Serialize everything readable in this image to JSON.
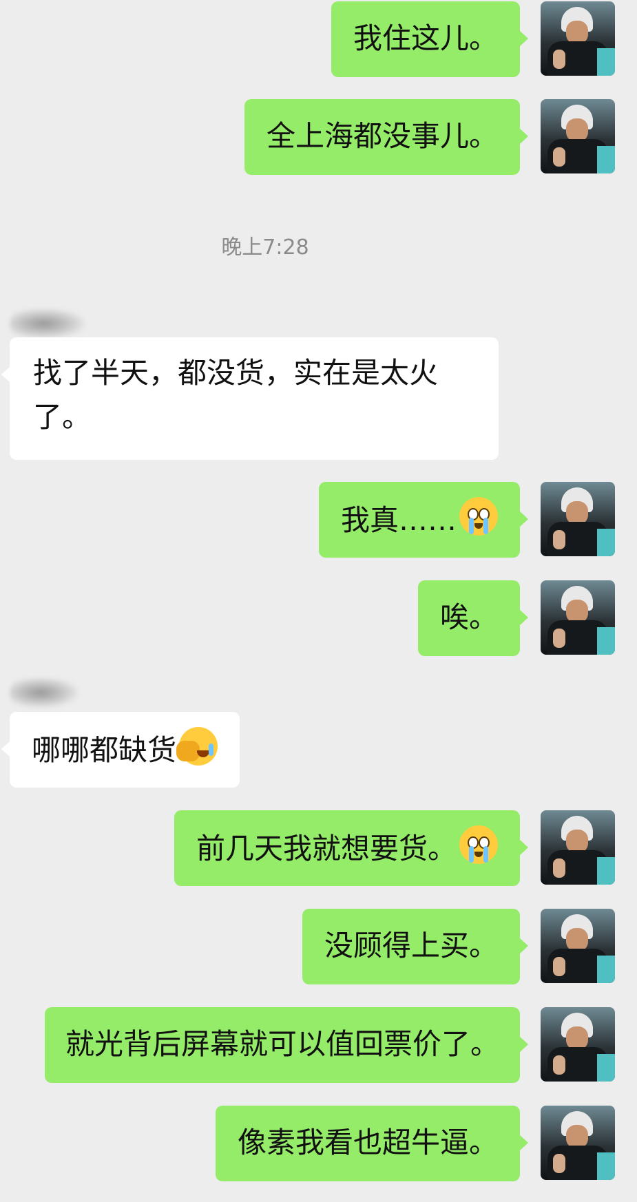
{
  "timestamp": "晚上7:28",
  "messages": [
    {
      "from": "me",
      "text": "我住这儿。"
    },
    {
      "from": "me",
      "text": "全上海都没事儿。"
    },
    {
      "from": "other",
      "text": "找了半天，都没货，实在是太火了。"
    },
    {
      "from": "me",
      "text": "我真……",
      "emoji": "crying-face-emoji"
    },
    {
      "from": "me",
      "text": "唉。"
    },
    {
      "from": "other",
      "text": "哪哪都缺货",
      "emoji": "facepalm-emoji"
    },
    {
      "from": "me",
      "text": "前几天我就想要货。",
      "emoji": "crying-face-emoji"
    },
    {
      "from": "me",
      "text": "没顾得上买。"
    },
    {
      "from": "me",
      "text": "就光背后屏幕就可以值回票价了。"
    },
    {
      "from": "me",
      "text": "像素我看也超牛逼。"
    }
  ],
  "colors": {
    "background": "#ededed",
    "my_bubble": "#95ec69",
    "other_bubble": "#ffffff",
    "timestamp_text": "#8a8a8a"
  }
}
